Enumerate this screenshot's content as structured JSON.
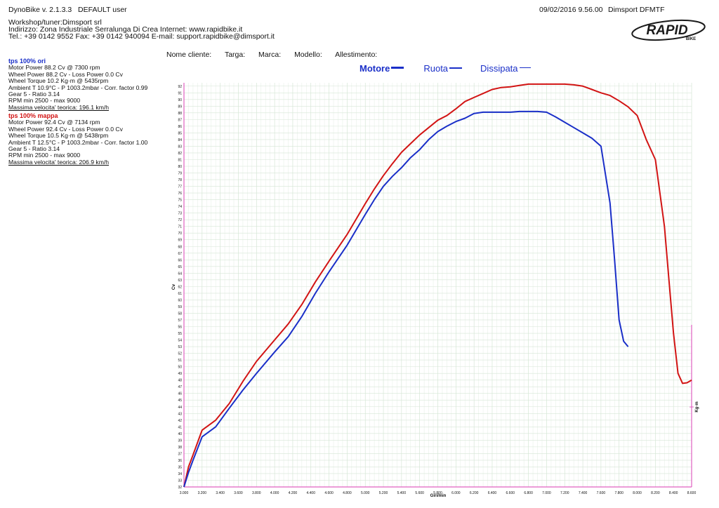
{
  "header": {
    "app": "DynoBike v. 2.1.3.3",
    "user": "DEFAULT user",
    "datetime": "09/02/2016 9.56.00",
    "vendor": "Dimsport DFMTF"
  },
  "workshop": {
    "line1": "Workshop/tuner:Dimsport srl",
    "line2": "Indirizzo: Zona Industriale Serralunga Di Crea Internet: www.rapidbike.it",
    "line3": "Tel.: +39 0142 9552 Fax: +39 0142 940094 E-mail: support.rapidbike@dimsport.it"
  },
  "logo": {
    "text": "RAPID",
    "sub": "BIKE",
    "color": "#1a1a1a"
  },
  "meta": {
    "cliente": "Nome cliente:",
    "targa": "Targa:",
    "marca": "Marca:",
    "modello": "Modello:",
    "allestimento": "Allestimento:"
  },
  "runs": [
    {
      "title": "tps 100% ori",
      "color": "#1a2fc8",
      "motor_power": "Motor Power 88.2 Cv  @ 7300 rpm",
      "wheel_power": "Wheel Power 88.2 Cv  - Loss Power 0.0 Cv",
      "wheel_torque": "Wheel Torque 10.2 Kg·m  @ 5435rpm",
      "ambient": "Ambient T 10.9°C - P 1003.2mbar - Corr. factor 0.99",
      "gear": "Gear 5 - Ratio 3.14",
      "rpm": "RPM min 2500 - max 9000",
      "vmax": "Massima velocita' teorica: 196.1 km/h"
    },
    {
      "title": "tps 100% mappa",
      "color": "#d21414",
      "motor_power": "Motor Power 92.4 Cv  @ 7134 rpm",
      "wheel_power": "Wheel Power 92.4 Cv  - Loss Power 0.0 Cv",
      "wheel_torque": "Wheel Torque 10.5 Kg·m  @ 5438rpm",
      "ambient": "Ambient T 12.5°C - P 1003.2mbar - Corr. factor 1.00",
      "gear": "Gear 5 - Ratio 3.14",
      "rpm": "RPM min 2500 - max 9000",
      "vmax": "Massima velocita' teorica: 206.9 km/h"
    }
  ],
  "legend": {
    "motore": "Motore",
    "ruota": "Ruota",
    "dissipata": "Dissipata",
    "motore_color": "#1a2fc8",
    "ruota_color": "#1a2fc8",
    "dissipata_color": "#1a2fc8"
  },
  "chart_data": {
    "type": "line",
    "xlabel": "Giri/min",
    "ylabel": "Cv",
    "y2label": "Kg·m",
    "xlim": [
      3000,
      8600
    ],
    "ylim": [
      32,
      92.5
    ],
    "x_ticks": [
      3000,
      3200,
      3400,
      3600,
      3800,
      4000,
      4200,
      4400,
      4600,
      4800,
      5000,
      5200,
      5400,
      5600,
      5800,
      6000,
      6200,
      6400,
      6600,
      6800,
      7000,
      7200,
      7400,
      7600,
      7800,
      8000,
      8200,
      8400,
      8600
    ],
    "x_tick_labels": [
      "3.000",
      "3.200",
      "3.400",
      "3.600",
      "3.800",
      "4.000",
      "4.200",
      "4.400",
      "4.600",
      "4.800",
      "5.000",
      "5.200",
      "5.400",
      "5.600",
      "5.800",
      "6.000",
      "6.200",
      "6.400",
      "6.600",
      "6.800",
      "7.000",
      "7.200",
      "7.400",
      "7.600",
      "7.800",
      "8.000",
      "8.200",
      "8.400",
      "8.600"
    ],
    "y_ticks": [
      32,
      33,
      34,
      35,
      36,
      37,
      38,
      39,
      40,
      41,
      42,
      43,
      44,
      45,
      46,
      47,
      48,
      49,
      50,
      51,
      52,
      53,
      54,
      55,
      56,
      57,
      58,
      59,
      60,
      61,
      62,
      63,
      64,
      65,
      66,
      67,
      68,
      69,
      70,
      71,
      72,
      73,
      74,
      75,
      76,
      77,
      78,
      79,
      80,
      81,
      82,
      83,
      84,
      85,
      86,
      87,
      88,
      89,
      90,
      91,
      92
    ],
    "grid": true,
    "series": [
      {
        "name": "tps 100% mappa",
        "color": "#d21414",
        "x": [
          3000,
          3050,
          3100,
          3200,
          3350,
          3500,
          3650,
          3800,
          4000,
          4150,
          4300,
          4450,
          4600,
          4800,
          5000,
          5100,
          5200,
          5300,
          5400,
          5500,
          5600,
          5700,
          5800,
          5900,
          6000,
          6100,
          6200,
          6300,
          6400,
          6500,
          6600,
          6700,
          6800,
          6900,
          7000,
          7100,
          7200,
          7300,
          7400,
          7500,
          7600,
          7700,
          7800,
          7900,
          8000,
          8100,
          8200,
          8300,
          8350,
          8400,
          8450,
          8500,
          8550,
          8600
        ],
        "y": [
          32,
          35,
          36.8,
          40.5,
          42,
          44.5,
          47.8,
          50.8,
          54,
          56.4,
          59.3,
          62.7,
          65.8,
          69.8,
          74.4,
          76.6,
          78.6,
          80.4,
          82.1,
          83.4,
          84.7,
          85.8,
          86.9,
          87.6,
          88.6,
          89.7,
          90.3,
          90.9,
          91.5,
          91.8,
          91.9,
          92.1,
          92.3,
          92.3,
          92.3,
          92.3,
          92.3,
          92.2,
          92,
          91.5,
          91,
          90.6,
          89.8,
          88.9,
          87.6,
          84,
          81,
          71,
          63,
          55,
          49,
          47.5,
          47.6,
          48
        ]
      },
      {
        "name": "tps 100% ori",
        "color": "#1a2fc8",
        "x": [
          3000,
          3050,
          3100,
          3200,
          3350,
          3500,
          3650,
          3800,
          4000,
          4150,
          4300,
          4450,
          4600,
          4800,
          5000,
          5100,
          5200,
          5300,
          5400,
          5500,
          5600,
          5700,
          5800,
          5900,
          6000,
          6100,
          6200,
          6300,
          6400,
          6500,
          6600,
          6700,
          6800,
          6900,
          7000,
          7100,
          7200,
          7300,
          7400,
          7500,
          7600,
          7700,
          7750,
          7800,
          7850,
          7900
        ],
        "y": [
          32,
          34.2,
          36,
          39.5,
          41,
          43.8,
          46.5,
          49,
          52.2,
          54.5,
          57.5,
          61,
          64.2,
          68.2,
          72.8,
          75,
          77,
          78.5,
          79.8,
          81.3,
          82.5,
          84,
          85.2,
          86,
          86.7,
          87.2,
          87.9,
          88.1,
          88.1,
          88.1,
          88.1,
          88.2,
          88.2,
          88.2,
          88.1,
          87.4,
          86.6,
          85.8,
          85,
          84.2,
          83,
          74.5,
          66,
          57,
          53.8,
          53
        ]
      }
    ]
  }
}
